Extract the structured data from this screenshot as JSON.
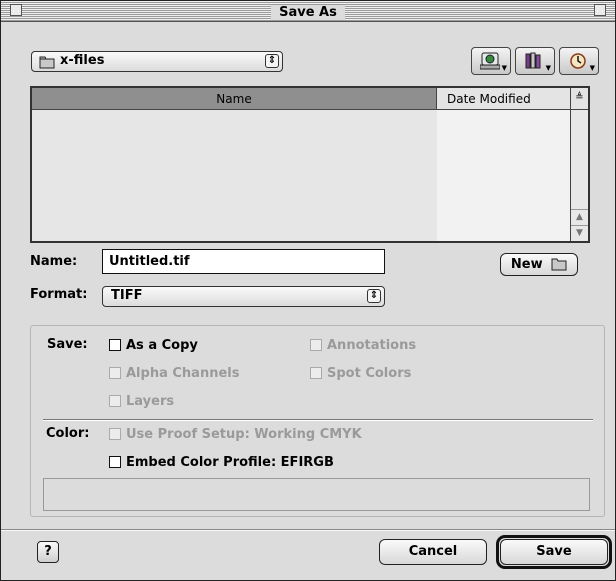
{
  "window": {
    "title": "Save As"
  },
  "location": {
    "folder": "x-files"
  },
  "nav_buttons": [
    {
      "icon": "globe-computer-icon"
    },
    {
      "icon": "books-favorites-icon"
    },
    {
      "icon": "clock-recent-icon"
    }
  ],
  "file_list": {
    "columns": [
      "Name",
      "Date Modified"
    ],
    "rows": []
  },
  "name_field": {
    "label": "Name:",
    "value": "Untitled.tif"
  },
  "new_folder_button": {
    "label": "New"
  },
  "format": {
    "label": "Format:",
    "value": "TIFF"
  },
  "save_options": {
    "label": "Save:",
    "as_a_copy": "As a Copy",
    "annotations": "Annotations",
    "alpha_channels": "Alpha Channels",
    "spot_colors": "Spot Colors",
    "layers": "Layers"
  },
  "color_options": {
    "label": "Color:",
    "use_proof_setup": "Use Proof Setup: Working CMYK",
    "embed_color_profile": "Embed Color Profile: EFIRGB"
  },
  "buttons": {
    "help": "?",
    "cancel": "Cancel",
    "save": "Save"
  },
  "colors": {
    "dialog_bg": "#dcdcdc",
    "header_selected": "#8f8f8f",
    "disabled_text": "#9a9a9a"
  }
}
